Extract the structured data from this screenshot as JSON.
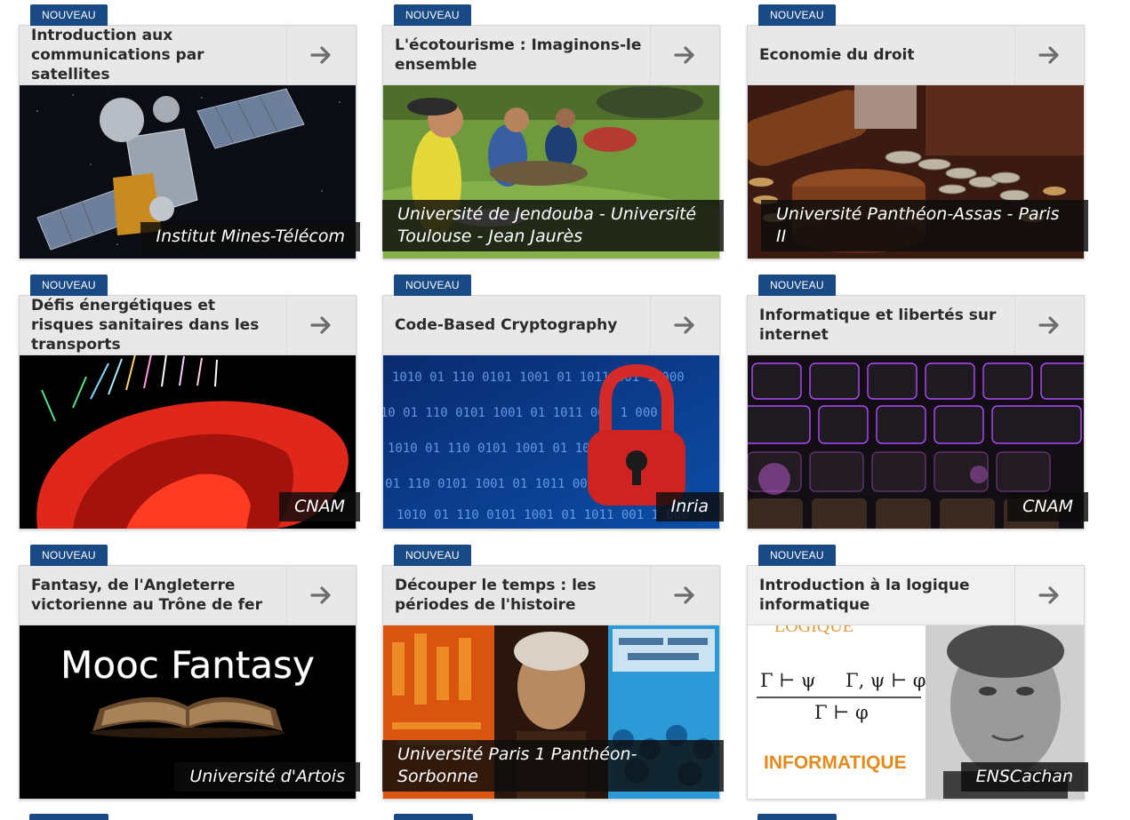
{
  "badge_label": "NOUVEAU",
  "colors": {
    "badge": "#1a4a86",
    "header_bg": "#f0f0f0",
    "title_text": "#2a2a2a",
    "arrow": "#6d6d6d",
    "institution_bg": "#0c0c0c"
  },
  "courses": [
    {
      "title": "Introduction aux communications par satellites",
      "institution": "Institut Mines-Télécom",
      "image": "satellite-in-space"
    },
    {
      "title": "L'écotourisme : Imaginons-le ensemble",
      "institution": "Université de Jendouba - Université Toulouse - Jean Jaurès",
      "image": "hikers-resting-on-grass"
    },
    {
      "title": "Economie du droit",
      "institution": "Université Panthéon-Assas - Paris II",
      "image": "gavel-and-coins"
    },
    {
      "title": "Défis énergétiques et risques sanitaires dans les transports",
      "institution": "CNAM",
      "image": "red-3d-field-visualization"
    },
    {
      "title": "Code-Based Cryptography",
      "institution": "Inria",
      "image": "padlock-over-binary-code"
    },
    {
      "title": "Informatique et libertés sur internet",
      "institution": "CNAM",
      "image": "illuminated-keyboard"
    },
    {
      "title": "Fantasy, de l'Angleterre victorienne au Trône de fer",
      "institution": "Université d'Artois",
      "image": "mooc-fantasy-open-book"
    },
    {
      "title": "Découper le temps : les périodes de l'histoire",
      "institution": "Université Paris 1 Panthéon-Sorbonne",
      "image": "history-collage"
    },
    {
      "title": "Introduction à la logique informatique",
      "institution": "ENSCachan",
      "image": "logic-rules-and-portrait"
    }
  ],
  "image_text": {
    "mooc_fantasy": "Mooc Fantasy",
    "logique": "LOGIQUE",
    "informatique": "INFORMATIQUE",
    "rule_left_premise": "Γ ⊢ ψ",
    "rule_right_premise": "Γ, ψ ⊢ φ",
    "rule_conclusion": "Γ ⊢ φ",
    "crypto_digits": "1010 01 110 0101 1001 01 1011 001 1 000"
  }
}
